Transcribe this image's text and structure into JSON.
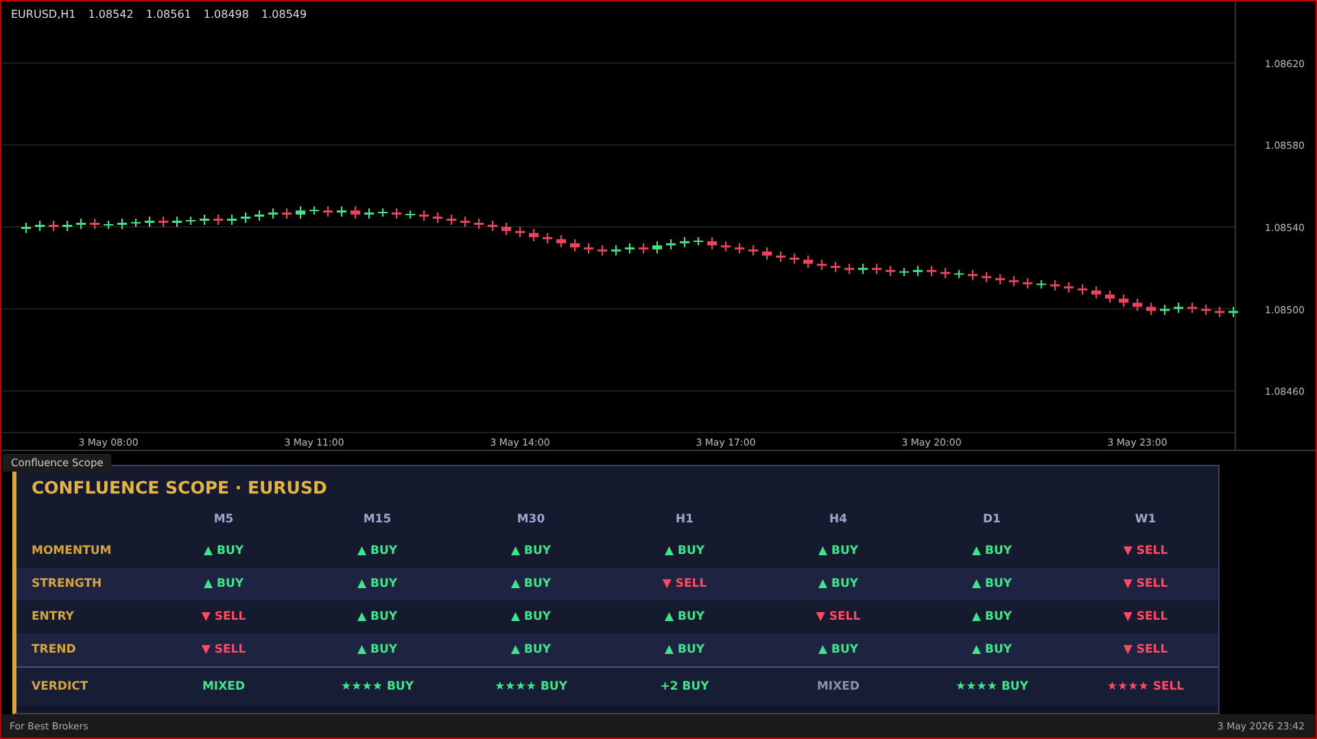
{
  "chart": {
    "header": [
      "EURUSD,H1",
      "1.08542",
      "1.08561",
      "1.08498",
      "1.08549"
    ],
    "chart_data": {
      "type": "candlestick",
      "grid": true,
      "ylim": [
        1.0844,
        1.0865
      ],
      "categories": [
        null,
        null,
        null,
        null,
        null,
        null,
        "3 May 08:00",
        null,
        null,
        null,
        null,
        null,
        null,
        null,
        null,
        null,
        null,
        null,
        null,
        null,
        null,
        "3 May 11:00",
        null,
        null,
        null,
        null,
        null,
        null,
        null,
        null,
        null,
        null,
        null,
        null,
        null,
        null,
        "3 May 14:00",
        null,
        null,
        null,
        null,
        null,
        null,
        null,
        null,
        null,
        null,
        null,
        null,
        null,
        null,
        "3 May 17:00",
        null,
        null,
        null,
        null,
        null,
        null,
        null,
        null,
        null,
        null,
        null,
        null,
        null,
        null,
        "3 May 20:00",
        null,
        null,
        null,
        null,
        null,
        null,
        null,
        null,
        null,
        null,
        null,
        null,
        null,
        null,
        "3 May 23:00",
        null,
        null,
        null,
        null,
        null,
        null,
        null
      ],
      "yticks": [
        {
          "value": 1.0862,
          "label": "1.08620"
        },
        {
          "value": 1.0858,
          "label": "1.08580"
        },
        {
          "value": 1.0854,
          "label": "1.08540"
        },
        {
          "value": 1.085,
          "label": "1.08500"
        },
        {
          "value": 1.0846,
          "label": "1.08460"
        }
      ],
      "ohlc": [
        [
          1.08539,
          1.08542,
          1.08537,
          1.0854
        ],
        [
          1.0854,
          1.08543,
          1.08538,
          1.08541
        ],
        [
          1.08541,
          1.08543,
          1.08538,
          1.0854
        ],
        [
          1.0854,
          1.08543,
          1.08538,
          1.08541
        ],
        [
          1.08541,
          1.08544,
          1.08539,
          1.08542
        ],
        [
          1.08542,
          1.08544,
          1.08539,
          1.08541
        ],
        [
          1.08541,
          1.08543,
          1.08539,
          1.08541
        ],
        [
          1.08541,
          1.08544,
          1.08539,
          1.08542
        ],
        [
          1.08542,
          1.08544,
          1.0854,
          1.08542
        ],
        [
          1.08542,
          1.08545,
          1.0854,
          1.08543
        ],
        [
          1.08543,
          1.08545,
          1.0854,
          1.08542
        ],
        [
          1.08542,
          1.08545,
          1.0854,
          1.08543
        ],
        [
          1.08543,
          1.08545,
          1.08541,
          1.08543
        ],
        [
          1.08543,
          1.08546,
          1.08541,
          1.08544
        ],
        [
          1.08544,
          1.08546,
          1.08541,
          1.08543
        ],
        [
          1.08543,
          1.08546,
          1.08541,
          1.08544
        ],
        [
          1.08544,
          1.08547,
          1.08542,
          1.08545
        ],
        [
          1.08545,
          1.08548,
          1.08543,
          1.08546
        ],
        [
          1.08546,
          1.08549,
          1.08544,
          1.08547
        ],
        [
          1.08547,
          1.08549,
          1.08544,
          1.08546
        ],
        [
          1.08546,
          1.0855,
          1.08544,
          1.08548
        ],
        [
          1.08548,
          1.0855,
          1.08546,
          1.08548
        ],
        [
          1.08548,
          1.0855,
          1.08545,
          1.08547
        ],
        [
          1.08547,
          1.0855,
          1.08545,
          1.08548
        ],
        [
          1.08548,
          1.0855,
          1.08544,
          1.08546
        ],
        [
          1.08546,
          1.08549,
          1.08544,
          1.08547
        ],
        [
          1.08547,
          1.08549,
          1.08545,
          1.08547
        ],
        [
          1.08547,
          1.08549,
          1.08544,
          1.08546
        ],
        [
          1.08546,
          1.08548,
          1.08544,
          1.08546
        ],
        [
          1.08546,
          1.08548,
          1.08543,
          1.08545
        ],
        [
          1.08545,
          1.08547,
          1.08542,
          1.08544
        ],
        [
          1.08544,
          1.08546,
          1.08541,
          1.08543
        ],
        [
          1.08543,
          1.08545,
          1.0854,
          1.08542
        ],
        [
          1.08542,
          1.08544,
          1.08539,
          1.08541
        ],
        [
          1.08541,
          1.08543,
          1.08538,
          1.0854
        ],
        [
          1.0854,
          1.08542,
          1.08536,
          1.08538
        ],
        [
          1.08538,
          1.0854,
          1.08535,
          1.08537
        ],
        [
          1.08537,
          1.08539,
          1.08533,
          1.08535
        ],
        [
          1.08535,
          1.08537,
          1.08532,
          1.08534
        ],
        [
          1.08534,
          1.08536,
          1.0853,
          1.08532
        ],
        [
          1.08532,
          1.08534,
          1.08528,
          1.0853
        ],
        [
          1.0853,
          1.08532,
          1.08527,
          1.08529
        ],
        [
          1.08529,
          1.08531,
          1.08526,
          1.08528
        ],
        [
          1.08528,
          1.08531,
          1.08526,
          1.08529
        ],
        [
          1.08529,
          1.08532,
          1.08527,
          1.0853
        ],
        [
          1.0853,
          1.08532,
          1.08527,
          1.08529
        ],
        [
          1.08529,
          1.08533,
          1.08527,
          1.08531
        ],
        [
          1.08531,
          1.08534,
          1.08529,
          1.08532
        ],
        [
          1.08532,
          1.08535,
          1.0853,
          1.08533
        ],
        [
          1.08533,
          1.08535,
          1.08531,
          1.08533
        ],
        [
          1.08533,
          1.08535,
          1.08529,
          1.08531
        ],
        [
          1.08531,
          1.08533,
          1.08528,
          1.0853
        ],
        [
          1.0853,
          1.08532,
          1.08527,
          1.08529
        ],
        [
          1.08529,
          1.08531,
          1.08526,
          1.08528
        ],
        [
          1.08528,
          1.0853,
          1.08524,
          1.08526
        ],
        [
          1.08526,
          1.08528,
          1.08523,
          1.08525
        ],
        [
          1.08525,
          1.08527,
          1.08522,
          1.08524
        ],
        [
          1.08524,
          1.08526,
          1.0852,
          1.08522
        ],
        [
          1.08522,
          1.08524,
          1.08519,
          1.08521
        ],
        [
          1.08521,
          1.08523,
          1.08518,
          1.0852
        ],
        [
          1.0852,
          1.08522,
          1.08517,
          1.08519
        ],
        [
          1.08519,
          1.08522,
          1.08517,
          1.0852
        ],
        [
          1.0852,
          1.08522,
          1.08517,
          1.08519
        ],
        [
          1.08519,
          1.08521,
          1.08516,
          1.08518
        ],
        [
          1.08518,
          1.0852,
          1.08516,
          1.08518
        ],
        [
          1.08518,
          1.08521,
          1.08516,
          1.08519
        ],
        [
          1.08519,
          1.08521,
          1.08516,
          1.08518
        ],
        [
          1.08518,
          1.0852,
          1.08515,
          1.08517
        ],
        [
          1.08517,
          1.08519,
          1.08515,
          1.08517
        ],
        [
          1.08517,
          1.08519,
          1.08514,
          1.08516
        ],
        [
          1.08516,
          1.08518,
          1.08513,
          1.08515
        ],
        [
          1.08515,
          1.08517,
          1.08512,
          1.08514
        ],
        [
          1.08514,
          1.08516,
          1.08511,
          1.08513
        ],
        [
          1.08513,
          1.08515,
          1.0851,
          1.08512
        ],
        [
          1.08512,
          1.08514,
          1.0851,
          1.08512
        ],
        [
          1.08512,
          1.08514,
          1.08509,
          1.08511
        ],
        [
          1.08511,
          1.08513,
          1.08508,
          1.0851
        ],
        [
          1.0851,
          1.08512,
          1.08507,
          1.08509
        ],
        [
          1.08509,
          1.08511,
          1.08505,
          1.08507
        ],
        [
          1.08507,
          1.08509,
          1.08503,
          1.08505
        ],
        [
          1.08505,
          1.08507,
          1.08501,
          1.08503
        ],
        [
          1.08503,
          1.08505,
          1.08499,
          1.08501
        ],
        [
          1.08501,
          1.08503,
          1.08497,
          1.08499
        ],
        [
          1.08499,
          1.08502,
          1.08497,
          1.085
        ],
        [
          1.085,
          1.08503,
          1.08498,
          1.08501
        ],
        [
          1.08501,
          1.08503,
          1.08498,
          1.085
        ],
        [
          1.085,
          1.08502,
          1.08497,
          1.08499
        ],
        [
          1.08499,
          1.08501,
          1.08496,
          1.08498
        ],
        [
          1.08498,
          1.08501,
          1.08496,
          1.08499
        ]
      ]
    }
  },
  "panel": {
    "tab": "Confluence Scope",
    "title": "CONFLUENCE SCOPE · EURUSD",
    "columns": [
      "M5",
      "M15",
      "M30",
      "H1",
      "H4",
      "D1",
      "W1"
    ],
    "rows": [
      {
        "label": "MOMENTUM",
        "cells": [
          {
            "text": "▲ BUY",
            "color": "#3ee68a"
          },
          {
            "text": "▲ BUY",
            "color": "#3ee68a"
          },
          {
            "text": "▲ BUY",
            "color": "#3ee68a"
          },
          {
            "text": "▲ BUY",
            "color": "#3ee68a"
          },
          {
            "text": "▲ BUY",
            "color": "#3ee68a"
          },
          {
            "text": "▲ BUY",
            "color": "#3ee68a"
          },
          {
            "text": "▼ SELL",
            "color": "#ff4a62"
          }
        ]
      },
      {
        "label": "STRENGTH",
        "cells": [
          {
            "text": "▲ BUY",
            "color": "#3ee68a"
          },
          {
            "text": "▲ BUY",
            "color": "#3ee68a"
          },
          {
            "text": "▲ BUY",
            "color": "#3ee68a"
          },
          {
            "text": "▼ SELL",
            "color": "#ff4a62"
          },
          {
            "text": "▲ BUY",
            "color": "#3ee68a"
          },
          {
            "text": "▲ BUY",
            "color": "#3ee68a"
          },
          {
            "text": "▼ SELL",
            "color": "#ff4a62"
          }
        ]
      },
      {
        "label": "ENTRY",
        "cells": [
          {
            "text": "▼ SELL",
            "color": "#ff4a62"
          },
          {
            "text": "▲ BUY",
            "color": "#3ee68a"
          },
          {
            "text": "▲ BUY",
            "color": "#3ee68a"
          },
          {
            "text": "▲ BUY",
            "color": "#3ee68a"
          },
          {
            "text": "▼ SELL",
            "color": "#ff4a62"
          },
          {
            "text": "▲ BUY",
            "color": "#3ee68a"
          },
          {
            "text": "▼ SELL",
            "color": "#ff4a62"
          }
        ]
      },
      {
        "label": "TREND",
        "cells": [
          {
            "text": "▼ SELL",
            "color": "#ff4a62"
          },
          {
            "text": "▲ BUY",
            "color": "#3ee68a"
          },
          {
            "text": "▲ BUY",
            "color": "#3ee68a"
          },
          {
            "text": "▲ BUY",
            "color": "#3ee68a"
          },
          {
            "text": "▲ BUY",
            "color": "#3ee68a"
          },
          {
            "text": "▲ BUY",
            "color": "#3ee68a"
          },
          {
            "text": "▼ SELL",
            "color": "#ff4a62"
          }
        ]
      }
    ],
    "verdict": {
      "label": "VERDICT",
      "cells": [
        {
          "text": "MIXED",
          "color": "#3ee68a"
        },
        {
          "text": "★★★★ BUY",
          "color": "#3ee68a"
        },
        {
          "text": "★★★★ BUY",
          "color": "#3ee68a"
        },
        {
          "text": "+2 BUY",
          "color": "#3ee68a"
        },
        {
          "text": "MIXED",
          "color": "#8a90a8"
        },
        {
          "text": "★★★★ BUY",
          "color": "#3ee68a"
        },
        {
          "text": "★★★★ SELL",
          "color": "#ff4a62"
        }
      ]
    }
  },
  "status_bar": {
    "left": "For Best Brokers",
    "right": "3 May 2026 23:42"
  }
}
